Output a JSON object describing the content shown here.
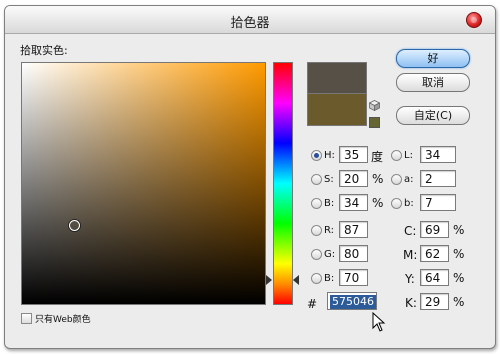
{
  "window": {
    "title": "拾色器"
  },
  "label_pick": "拾取实色:",
  "buttons": {
    "ok": "好",
    "cancel": "取消",
    "custom": "自定(C)"
  },
  "colors": {
    "new": "#575046",
    "old": "#6b5a2c",
    "websafe": "#666633"
  },
  "hsb": [
    {
      "label": "H:",
      "value": "35",
      "unit": "度",
      "selected": true
    },
    {
      "label": "S:",
      "value": "20",
      "unit": "%",
      "selected": false
    },
    {
      "label": "B:",
      "value": "34",
      "unit": "%",
      "selected": false
    }
  ],
  "lab": [
    {
      "label": "L:",
      "value": "34"
    },
    {
      "label": "a:",
      "value": "2"
    },
    {
      "label": "b:",
      "value": "7"
    }
  ],
  "rgb": [
    {
      "label": "R:",
      "value": "87"
    },
    {
      "label": "G:",
      "value": "80"
    },
    {
      "label": "B:",
      "value": "70"
    }
  ],
  "cmyk": [
    {
      "label": "C:",
      "value": "69",
      "unit": "%"
    },
    {
      "label": "M:",
      "value": "62",
      "unit": "%"
    },
    {
      "label": "Y:",
      "value": "64",
      "unit": "%"
    },
    {
      "label": "K:",
      "value": "29",
      "unit": "%"
    }
  ],
  "hex": {
    "prefix": "#",
    "value": "575046"
  },
  "web_only": {
    "label": "只有Web颜色",
    "checked": false
  }
}
